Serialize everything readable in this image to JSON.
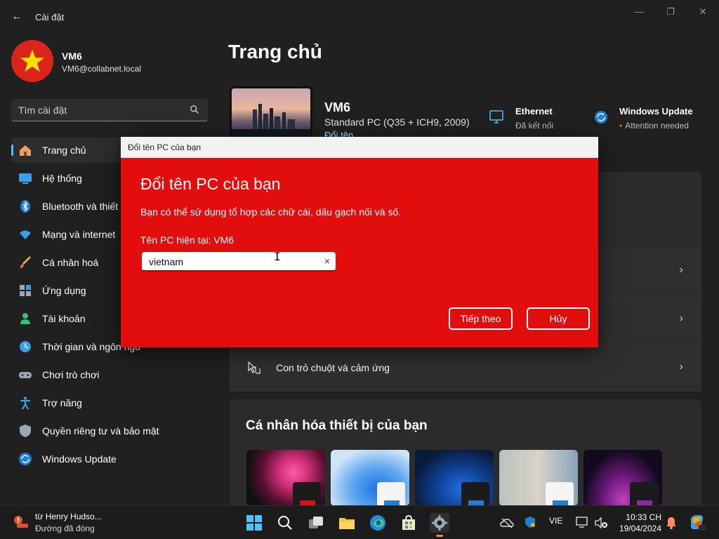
{
  "app": {
    "title": "Cài đặt"
  },
  "user": {
    "name": "VM6",
    "email": "VM6@collabnet.local"
  },
  "search": {
    "placeholder": "Tìm cài đặt"
  },
  "sidebar": {
    "items": [
      {
        "label": "Trang chủ",
        "icon": "home-icon",
        "active": true
      },
      {
        "label": "Hệ thống",
        "icon": "system-icon"
      },
      {
        "label": "Bluetooth và thiết",
        "icon": "bluetooth-icon"
      },
      {
        "label": "Mạng và internet",
        "icon": "wifi-icon"
      },
      {
        "label": "Cá nhân hoá",
        "icon": "brush-icon"
      },
      {
        "label": "Ứng dụng",
        "icon": "apps-icon"
      },
      {
        "label": "Tài khoản",
        "icon": "account-icon"
      },
      {
        "label": "Thời gian và ngôn ngữ",
        "icon": "time-language-icon"
      },
      {
        "label": "Chơi trò chơi",
        "icon": "gamepad-icon"
      },
      {
        "label": "Trợ năng",
        "icon": "accessibility-icon"
      },
      {
        "label": "Quyền riêng tư và bảo mật",
        "icon": "shield-icon"
      },
      {
        "label": "Windows Update",
        "icon": "update-icon"
      }
    ]
  },
  "main": {
    "title": "Trang chủ",
    "pc": {
      "name": "VM6",
      "model": "Standard PC (Q35 + ICH9, 2009)",
      "rename": "Đổi tên"
    },
    "ethernet": {
      "title": "Ethernet",
      "status": "Đã kết nối"
    },
    "windows_update": {
      "title": "Windows Update",
      "status": "Attention needed"
    },
    "rows": [
      {
        "label": "Con trỏ chuột và cảm ứng",
        "icon": "mouse-touch-icon"
      }
    ],
    "personalize_title": "Cá nhân hóa thiết bị của bạn"
  },
  "dialog": {
    "window_title": "Đổi tên PC của bạn",
    "heading": "Đổi tên PC của bạn",
    "description": "Bạn có thể sử dụng tổ hợp các chữ cái, dấu gạch nối và số.",
    "current": "Tên PC hiện tại: VM6",
    "input_value": "vietnam",
    "clear": "×",
    "next_button": "Tiếp theo",
    "cancel_button": "Hủy"
  },
  "taskbar": {
    "notification_title": "từ Henry Hudso...",
    "notification_sub": "Đường đã đóng",
    "language": "VIE",
    "time": "10:33 CH",
    "date": "19/04/2024"
  },
  "colors": {
    "accent": "#4cc2ff",
    "dialog_bg": "#e20d0d",
    "app_bg": "#202020"
  }
}
